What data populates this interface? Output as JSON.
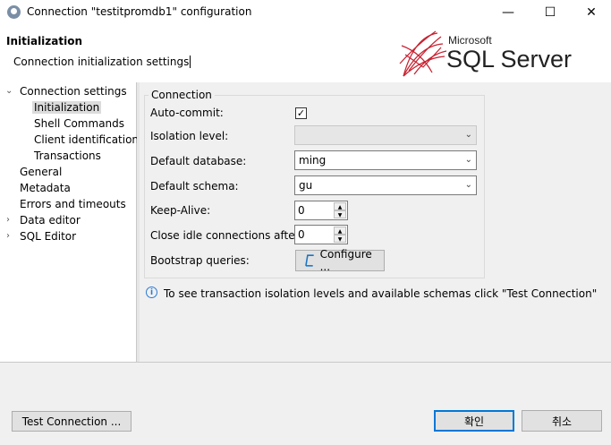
{
  "window": {
    "title": "Connection \"testitpromdb1\" configuration",
    "controls": {
      "minimize": "—",
      "maximize": "☐",
      "close": "✕"
    }
  },
  "header": {
    "title": "Initialization",
    "description": "Connection initialization settings",
    "logo": {
      "brand": "Microsoft",
      "product": "SQL Server"
    }
  },
  "tree": {
    "items": [
      {
        "label": "Connection settings",
        "expanded": true
      },
      {
        "label": "Initialization",
        "selected": true
      },
      {
        "label": "Shell Commands"
      },
      {
        "label": "Client identification"
      },
      {
        "label": "Transactions"
      },
      {
        "label": "General"
      },
      {
        "label": "Metadata"
      },
      {
        "label": "Errors and timeouts"
      },
      {
        "label": "Data editor",
        "expandable": true
      },
      {
        "label": "SQL Editor",
        "expandable": true
      }
    ]
  },
  "connection": {
    "group_title": "Connection",
    "auto_commit_label": "Auto-commit:",
    "auto_commit_checked": "✓",
    "isolation_level_label": "Isolation level:",
    "isolation_level_value": "",
    "default_database_label": "Default database:",
    "default_database_value": "ming",
    "default_schema_label": "Default schema:",
    "default_schema_value": "gu",
    "keep_alive_label": "Keep-Alive:",
    "keep_alive_value": "0",
    "close_idle_label": "Close idle connections after:",
    "close_idle_value": "0",
    "bootstrap_label": "Bootstrap queries:",
    "configure_label": "Configure ..."
  },
  "info": {
    "icon": "i",
    "text": "To see transaction isolation levels and available schemas click \"Test Connection\""
  },
  "footer": {
    "test_connection_label": "Test Connection ...",
    "ok_label": "확인",
    "cancel_label": "취소"
  },
  "colors": {
    "accent": "#0078d7",
    "logo_red": "#c8202f"
  }
}
